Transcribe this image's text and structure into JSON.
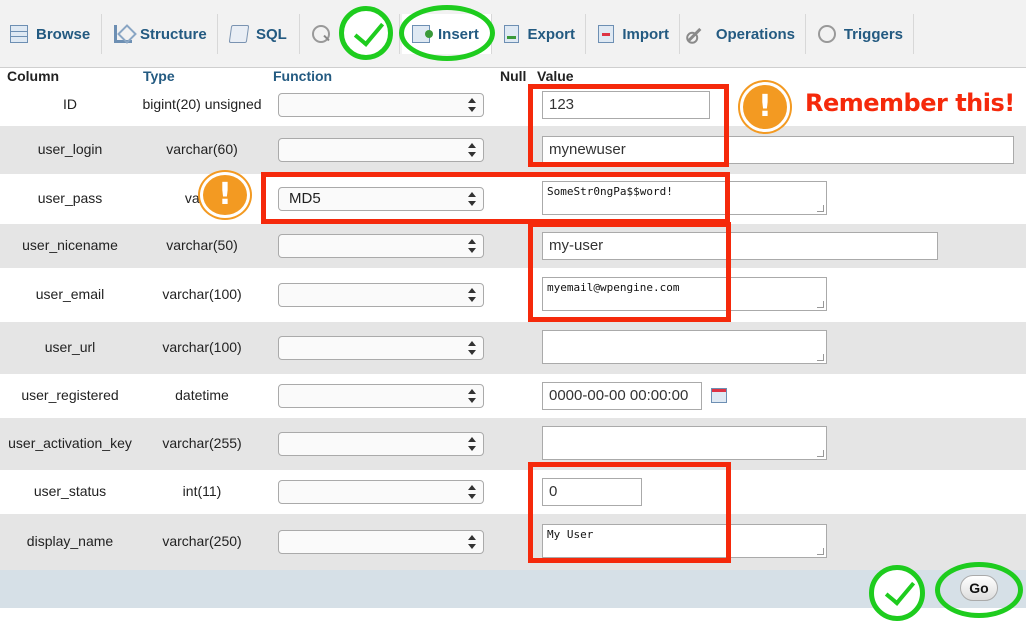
{
  "tabs": [
    {
      "label": "Browse",
      "icon": "table-icon"
    },
    {
      "label": "Structure",
      "icon": "structure-icon"
    },
    {
      "label": "SQL",
      "icon": "sql-icon"
    },
    {
      "label": "",
      "icon": "search-icon"
    },
    {
      "label": "Insert",
      "icon": "insert-icon",
      "active": true
    },
    {
      "label": "Export",
      "icon": "export-icon"
    },
    {
      "label": "Import",
      "icon": "import-icon"
    },
    {
      "label": "Operations",
      "icon": "wrench-icon"
    },
    {
      "label": "Triggers",
      "icon": "triggers-icon"
    }
  ],
  "headers": {
    "column": "Column",
    "type": "Type",
    "function": "Function",
    "null": "Null",
    "value": "Value"
  },
  "rows": [
    {
      "name": "ID",
      "type": "bigint(20) unsigned",
      "function": "",
      "value": "123",
      "input": "text"
    },
    {
      "name": "user_login",
      "type": "varchar(60)",
      "function": "",
      "value": "mynewuser",
      "input": "text"
    },
    {
      "name": "user_pass",
      "type": "varch",
      "function": "MD5",
      "value": "SomeStr0ngPa$$word!",
      "input": "textarea"
    },
    {
      "name": "user_nicename",
      "type": "varchar(50)",
      "function": "",
      "value": "my-user",
      "input": "text"
    },
    {
      "name": "user_email",
      "type": "varchar(100)",
      "function": "",
      "value": "myemail@wpengine.com",
      "input": "textarea"
    },
    {
      "name": "user_url",
      "type": "varchar(100)",
      "function": "",
      "value": "",
      "input": "textarea"
    },
    {
      "name": "user_registered",
      "type": "datetime",
      "function": "",
      "value": "0000-00-00 00:00:00",
      "input": "datetime"
    },
    {
      "name": "user_activation_key",
      "type": "varchar(255)",
      "function": "",
      "value": "",
      "input": "textarea"
    },
    {
      "name": "user_status",
      "type": "int(11)",
      "function": "",
      "value": "0",
      "input": "text"
    },
    {
      "name": "display_name",
      "type": "varchar(250)",
      "function": "",
      "value": "My User",
      "input": "textarea"
    }
  ],
  "go_label": "Go",
  "annotation": {
    "remember_text": "Remember this!",
    "warn_glyph": "!",
    "colors": {
      "highlight_red": "#f5290b",
      "ring_green": "#1ecc1e",
      "warn_orange": "#f39a22"
    }
  },
  "colors": {
    "link": "#235a81",
    "row_alt": "#e5e5e5",
    "footer": "#d6e0e7"
  }
}
